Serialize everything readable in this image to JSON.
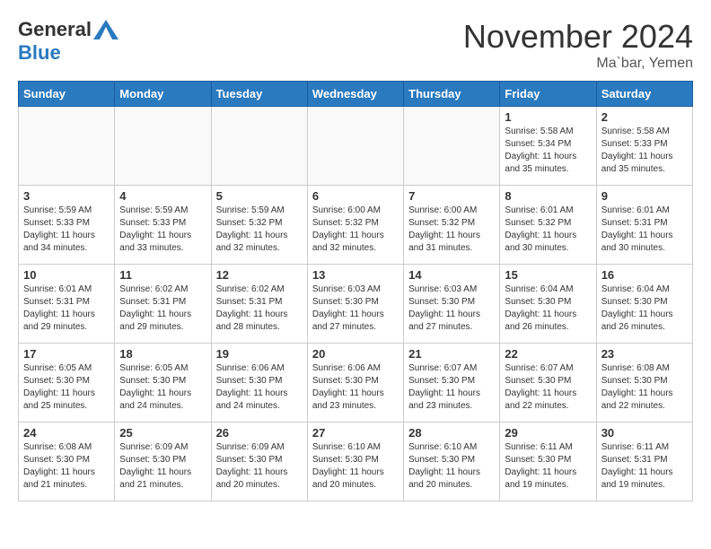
{
  "header": {
    "logo_general": "General",
    "logo_blue": "Blue",
    "month_title": "November 2024",
    "location": "Ma`bar, Yemen"
  },
  "weekdays": [
    "Sunday",
    "Monday",
    "Tuesday",
    "Wednesday",
    "Thursday",
    "Friday",
    "Saturday"
  ],
  "weeks": [
    [
      {
        "day": "",
        "info": ""
      },
      {
        "day": "",
        "info": ""
      },
      {
        "day": "",
        "info": ""
      },
      {
        "day": "",
        "info": ""
      },
      {
        "day": "",
        "info": ""
      },
      {
        "day": "1",
        "info": "Sunrise: 5:58 AM\nSunset: 5:34 PM\nDaylight: 11 hours\nand 35 minutes."
      },
      {
        "day": "2",
        "info": "Sunrise: 5:58 AM\nSunset: 5:33 PM\nDaylight: 11 hours\nand 35 minutes."
      }
    ],
    [
      {
        "day": "3",
        "info": "Sunrise: 5:59 AM\nSunset: 5:33 PM\nDaylight: 11 hours\nand 34 minutes."
      },
      {
        "day": "4",
        "info": "Sunrise: 5:59 AM\nSunset: 5:33 PM\nDaylight: 11 hours\nand 33 minutes."
      },
      {
        "day": "5",
        "info": "Sunrise: 5:59 AM\nSunset: 5:32 PM\nDaylight: 11 hours\nand 32 minutes."
      },
      {
        "day": "6",
        "info": "Sunrise: 6:00 AM\nSunset: 5:32 PM\nDaylight: 11 hours\nand 32 minutes."
      },
      {
        "day": "7",
        "info": "Sunrise: 6:00 AM\nSunset: 5:32 PM\nDaylight: 11 hours\nand 31 minutes."
      },
      {
        "day": "8",
        "info": "Sunrise: 6:01 AM\nSunset: 5:32 PM\nDaylight: 11 hours\nand 30 minutes."
      },
      {
        "day": "9",
        "info": "Sunrise: 6:01 AM\nSunset: 5:31 PM\nDaylight: 11 hours\nand 30 minutes."
      }
    ],
    [
      {
        "day": "10",
        "info": "Sunrise: 6:01 AM\nSunset: 5:31 PM\nDaylight: 11 hours\nand 29 minutes."
      },
      {
        "day": "11",
        "info": "Sunrise: 6:02 AM\nSunset: 5:31 PM\nDaylight: 11 hours\nand 29 minutes."
      },
      {
        "day": "12",
        "info": "Sunrise: 6:02 AM\nSunset: 5:31 PM\nDaylight: 11 hours\nand 28 minutes."
      },
      {
        "day": "13",
        "info": "Sunrise: 6:03 AM\nSunset: 5:30 PM\nDaylight: 11 hours\nand 27 minutes."
      },
      {
        "day": "14",
        "info": "Sunrise: 6:03 AM\nSunset: 5:30 PM\nDaylight: 11 hours\nand 27 minutes."
      },
      {
        "day": "15",
        "info": "Sunrise: 6:04 AM\nSunset: 5:30 PM\nDaylight: 11 hours\nand 26 minutes."
      },
      {
        "day": "16",
        "info": "Sunrise: 6:04 AM\nSunset: 5:30 PM\nDaylight: 11 hours\nand 26 minutes."
      }
    ],
    [
      {
        "day": "17",
        "info": "Sunrise: 6:05 AM\nSunset: 5:30 PM\nDaylight: 11 hours\nand 25 minutes."
      },
      {
        "day": "18",
        "info": "Sunrise: 6:05 AM\nSunset: 5:30 PM\nDaylight: 11 hours\nand 24 minutes."
      },
      {
        "day": "19",
        "info": "Sunrise: 6:06 AM\nSunset: 5:30 PM\nDaylight: 11 hours\nand 24 minutes."
      },
      {
        "day": "20",
        "info": "Sunrise: 6:06 AM\nSunset: 5:30 PM\nDaylight: 11 hours\nand 23 minutes."
      },
      {
        "day": "21",
        "info": "Sunrise: 6:07 AM\nSunset: 5:30 PM\nDaylight: 11 hours\nand 23 minutes."
      },
      {
        "day": "22",
        "info": "Sunrise: 6:07 AM\nSunset: 5:30 PM\nDaylight: 11 hours\nand 22 minutes."
      },
      {
        "day": "23",
        "info": "Sunrise: 6:08 AM\nSunset: 5:30 PM\nDaylight: 11 hours\nand 22 minutes."
      }
    ],
    [
      {
        "day": "24",
        "info": "Sunrise: 6:08 AM\nSunset: 5:30 PM\nDaylight: 11 hours\nand 21 minutes."
      },
      {
        "day": "25",
        "info": "Sunrise: 6:09 AM\nSunset: 5:30 PM\nDaylight: 11 hours\nand 21 minutes."
      },
      {
        "day": "26",
        "info": "Sunrise: 6:09 AM\nSunset: 5:30 PM\nDaylight: 11 hours\nand 20 minutes."
      },
      {
        "day": "27",
        "info": "Sunrise: 6:10 AM\nSunset: 5:30 PM\nDaylight: 11 hours\nand 20 minutes."
      },
      {
        "day": "28",
        "info": "Sunrise: 6:10 AM\nSunset: 5:30 PM\nDaylight: 11 hours\nand 20 minutes."
      },
      {
        "day": "29",
        "info": "Sunrise: 6:11 AM\nSunset: 5:30 PM\nDaylight: 11 hours\nand 19 minutes."
      },
      {
        "day": "30",
        "info": "Sunrise: 6:11 AM\nSunset: 5:31 PM\nDaylight: 11 hours\nand 19 minutes."
      }
    ]
  ]
}
